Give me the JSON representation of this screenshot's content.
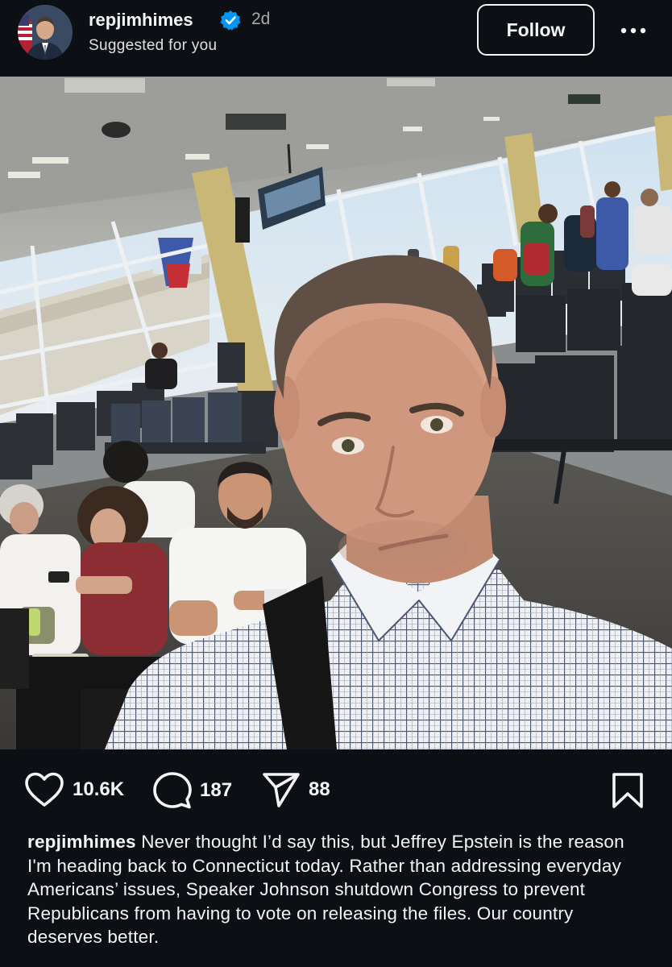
{
  "post": {
    "username": "repjimhimes",
    "verified": true,
    "age": "2d",
    "subtitle": "Suggested for you",
    "follow_label": "Follow",
    "photo_alt": "Selfie of a man in a plaid shirt at an airport gate waiting area"
  },
  "actions": {
    "likes": "10.6K",
    "comments": "187",
    "shares": "88"
  },
  "caption": {
    "username": "repjimhimes",
    "text": "Never thought I’d say this, but Jeffrey Epstein is the reason I'm heading back to Connecticut today. Rather than addressing everyday Americans’ issues, Speaker Johnson shutdown Congress to prevent Republicans from having to vote on releasing the files. Our country deserves better."
  },
  "colors": {
    "background": "#0c1014",
    "text": "#f5f5f5",
    "muted": "#a8a8a8",
    "verified_blue": "#0095f6"
  },
  "icons": {
    "verified": "verified-badge-icon",
    "more": "more-options-icon",
    "like": "heart-icon",
    "comment": "comment-icon",
    "share": "send-icon",
    "save": "bookmark-icon"
  }
}
